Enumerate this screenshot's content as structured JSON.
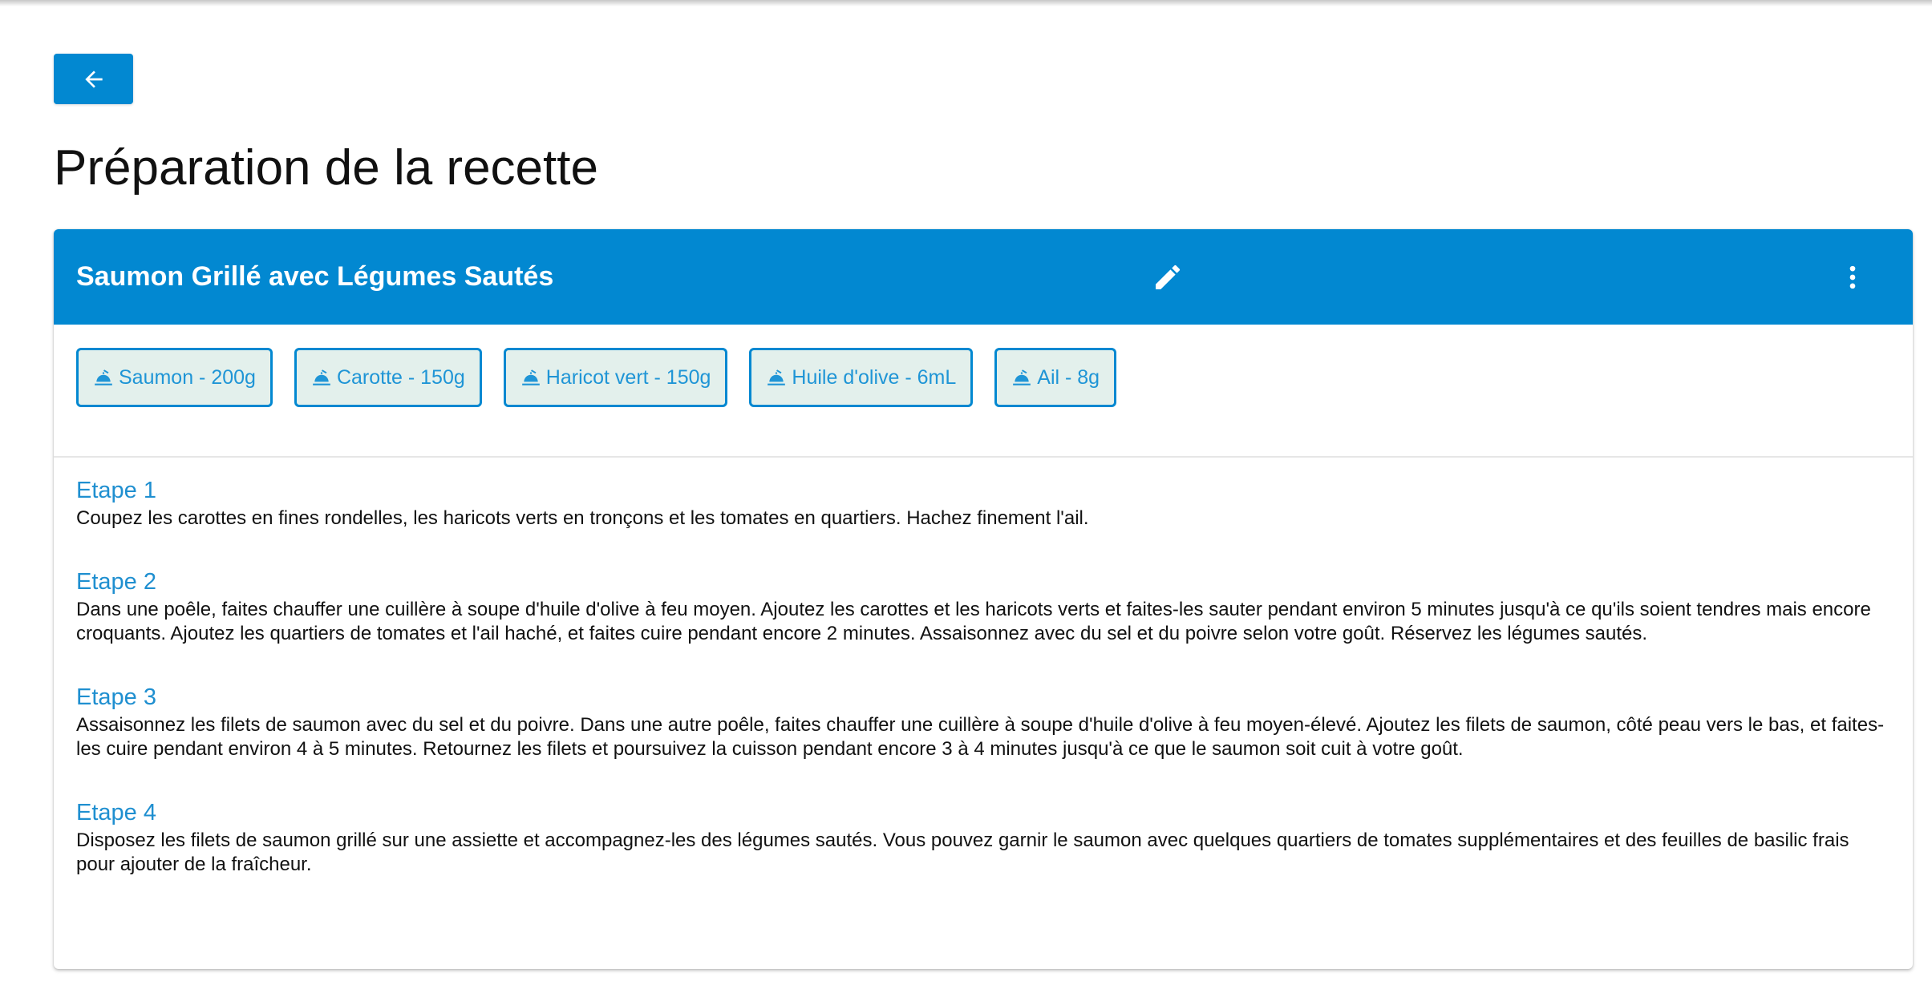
{
  "nav": {
    "back_icon": "arrow-left-icon"
  },
  "page": {
    "title": "Préparation de la recette"
  },
  "recipe": {
    "title": "Saumon Grillé avec Légumes Sautés",
    "header_color": "#0288d1",
    "edit_icon": "pencil-icon",
    "menu_icon": "more-vertical-icon"
  },
  "ingredients": [
    {
      "label": "Saumon - 200g",
      "icon": "food-bowl-icon"
    },
    {
      "label": "Carotte - 150g",
      "icon": "food-bowl-icon"
    },
    {
      "label": "Haricot vert - 150g",
      "icon": "food-bowl-icon"
    },
    {
      "label": "Huile d'olive - 6mL",
      "icon": "food-bowl-icon"
    },
    {
      "label": "Ail - 8g",
      "icon": "food-bowl-icon"
    }
  ],
  "steps": [
    {
      "title": "Etape 1",
      "text": "Coupez les carottes en fines rondelles, les haricots verts en tronçons et les tomates en quartiers. Hachez finement l'ail."
    },
    {
      "title": "Etape 2",
      "text": "Dans une poêle, faites chauffer une cuillère à soupe d'huile d'olive à feu moyen. Ajoutez les carottes et les haricots verts et faites-les sauter pendant environ 5 minutes jusqu'à ce qu'ils soient tendres mais encore croquants. Ajoutez les quartiers de tomates et l'ail haché, et faites cuire pendant encore 2 minutes. Assaisonnez avec du sel et du poivre selon votre goût. Réservez les légumes sautés."
    },
    {
      "title": "Etape 3",
      "text": "Assaisonnez les filets de saumon avec du sel et du poivre. Dans une autre poêle, faites chauffer une cuillère à soupe d'huile d'olive à feu moyen-élevé. Ajoutez les filets de saumon, côté peau vers le bas, et faites-les cuire pendant environ 4 à 5 minutes. Retournez les filets et poursuivez la cuisson pendant encore 3 à 4 minutes jusqu'à ce que le saumon soit cuit à votre goût."
    },
    {
      "title": "Etape 4",
      "text": "Disposez les filets de saumon grillé sur une assiette et accompagnez-les des légumes sautés. Vous pouvez garnir le saumon avec quelques quartiers de tomates supplémentaires et des feuilles de basilic frais pour ajouter de la fraîcheur."
    }
  ]
}
